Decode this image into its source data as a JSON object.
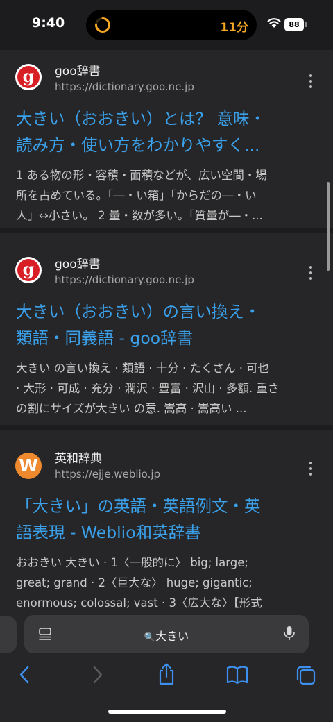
{
  "status_bar": {
    "time": "9:40",
    "timer": "11分",
    "battery": "88"
  },
  "results": [
    {
      "site_name": "goo辞書",
      "url": "https://dictionary.goo.ne.jp",
      "favicon": "goo-logo",
      "title_lines": [
        "大きい（おおきい）とは？ 意味・",
        "読み方・使い方をわかりやすく..."
      ],
      "snippet_lines": [
        "1 ある物の形・容積・面積などが、広い空間・場",
        "所を占めている。「―・い箱」「からだの―・い",
        "人」⇔小さい。 2 量・数が多い。「質量が―・..."
      ]
    },
    {
      "site_name": "goo辞書",
      "url": "https://dictionary.goo.ne.jp",
      "favicon": "goo-logo",
      "title_lines": [
        "大きい（おおきい）の言い換え・",
        "類語・同義語 - goo辞書"
      ],
      "snippet_lines": [
        "大きい の言い換え · 類語 · 十分 · たくさん · 可也",
        "· 大形 · 可成 · 充分 · 潤沢 · 豊富 · 沢山 · 多額. 重さ",
        "の割にサイズが大きい の意. 嵩高 · 嵩高い ..."
      ]
    },
    {
      "site_name": "英和辞典",
      "url": "https://ejje.weblio.jp",
      "favicon": "W",
      "title_lines": [
        "「大きい」の英語・英語例文・英",
        "語表現 - Weblio和英辞書"
      ],
      "snippet_lines": [
        "おおきい 大きい · 1〈一般的に〉 big; large;",
        "great; grand · 2〈巨大な〉 huge; gigantic;",
        "enormous; colossal; vast · 3〈広大な〉【形式"
      ]
    }
  ],
  "address_bar": {
    "search_icon": "🔍",
    "query": "大きい"
  },
  "toolbar": {
    "back": "back-icon",
    "forward": "forward-icon",
    "share": "share-icon",
    "bookmarks": "bookmarks-icon",
    "tabs": "tabs-icon"
  },
  "colors": {
    "link": "#3aa0ea",
    "background": "#1c1c1e",
    "card": "#262628",
    "timer": "#f5a623"
  }
}
